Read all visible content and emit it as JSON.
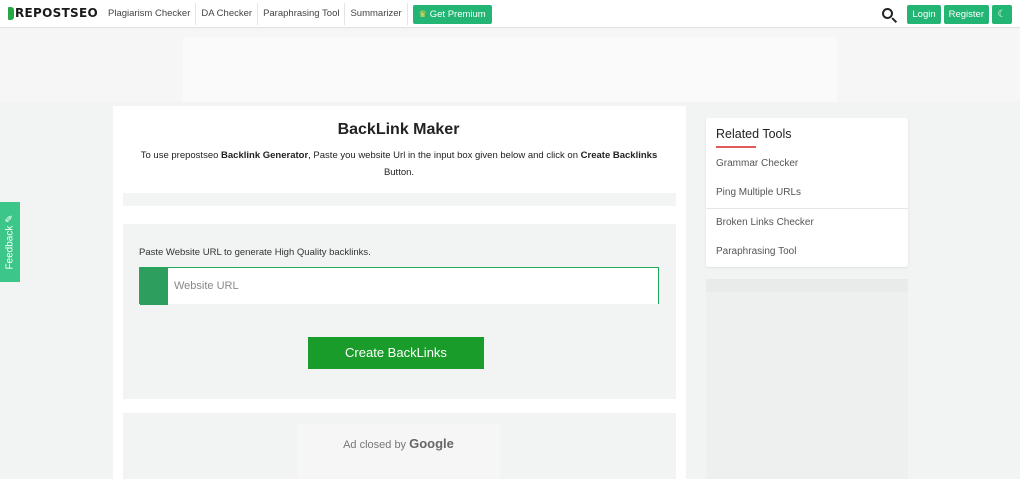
{
  "header": {
    "logo_text": "REPOSTSEO",
    "nav": [
      "Plagiarism Checker",
      "DA Checker",
      "Paraphrasing Tool",
      "Summarizer"
    ],
    "premium_label": "Get Premium",
    "login_label": "Login",
    "register_label": "Register"
  },
  "main": {
    "title": "BackLink Maker",
    "desc_prefix": "To use prepostseo ",
    "desc_bold1": "Backlink Generator",
    "desc_mid": ", Paste you website Url in the input box given below and click on ",
    "desc_bold2": "Create Backlinks",
    "desc_suffix": " Button.",
    "form_label": "Paste Website URL to generate High Quality backlinks.",
    "url_placeholder": "Website URL",
    "create_button": "Create BackLinks",
    "ad_closed_text": "Ad closed by ",
    "ad_closed_brand": "Google"
  },
  "sidebar": {
    "title": "Related Tools",
    "links": [
      "Grammar Checker",
      "Ping Multiple URLs",
      "Broken Links Checker",
      "Paraphrasing Tool"
    ]
  },
  "feedback": {
    "label": "Feedback"
  },
  "colors": {
    "brand_green": "#22b573",
    "button_green": "#1a9c2a",
    "accent_red": "#e25b5b"
  }
}
